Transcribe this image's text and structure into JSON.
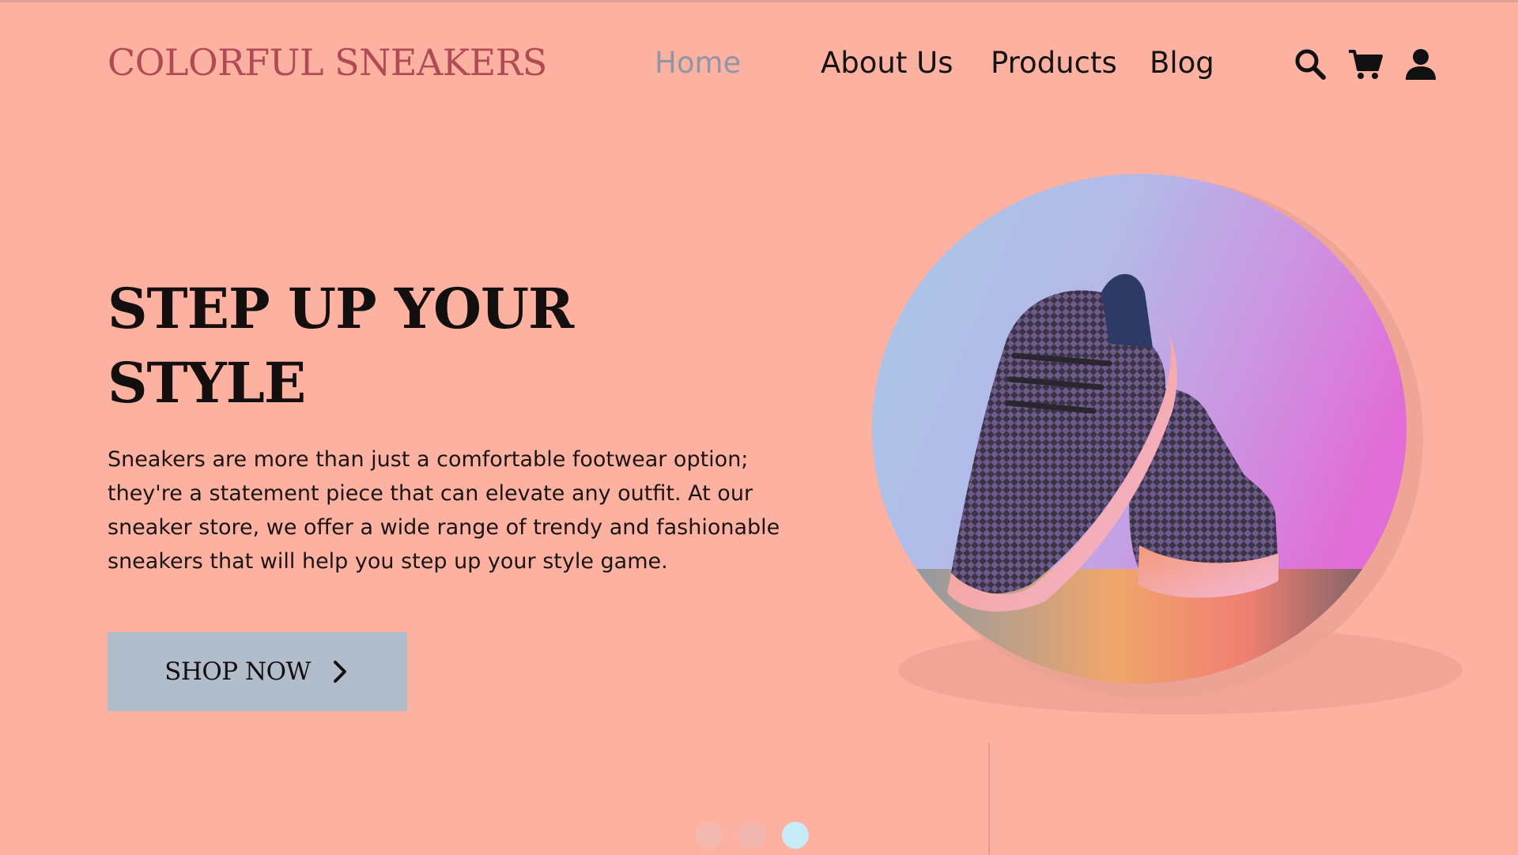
{
  "header": {
    "logo": "COLORFUL SNEAKERS",
    "nav": [
      {
        "label": "Home",
        "active": true
      },
      {
        "label": "About Us",
        "active": false
      },
      {
        "label": "Products",
        "active": false
      },
      {
        "label": "Blog",
        "active": false
      }
    ],
    "icons": [
      "search-icon",
      "cart-icon",
      "user-icon"
    ]
  },
  "hero": {
    "title_line1": "STEP UP YOUR",
    "title_line2": "STYLE",
    "description": "Sneakers are more than just a comfortable footwear option; they're a statement piece that can elevate any outfit. At our sneaker store, we offer a wide range of trendy and fashionable sneakers that will help you step up your style game.",
    "cta_label": "SHOP NOW",
    "cta_icon": "chevron-right-icon",
    "image": "sneakers-photo"
  },
  "carousel": {
    "dot_count": 3,
    "active_index": 3
  },
  "colors": {
    "background": "#fdb1a1",
    "logo": "#b04b56",
    "nav_active": "#8f96a5",
    "nav_text": "#161212",
    "button_bg": "#b2bdcb",
    "dot_active": "#c7ecf7"
  }
}
